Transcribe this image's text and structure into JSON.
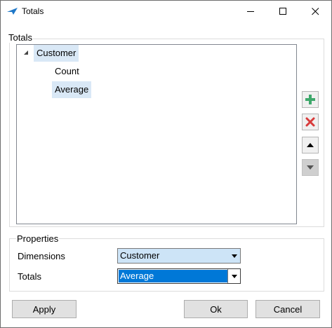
{
  "window": {
    "title": "Totals",
    "icon": "arrow-app-icon",
    "controls": [
      "minimize-icon",
      "maximize-icon",
      "close-icon"
    ]
  },
  "totals_group": {
    "label": "Totals",
    "tree": {
      "root": {
        "label": "Customer",
        "expanded": true,
        "selected": true
      },
      "children": [
        {
          "label": "Count",
          "selected": false
        },
        {
          "label": "Average",
          "selected": true
        }
      ]
    },
    "side_buttons": [
      {
        "icon": "plus-icon",
        "color": "#3ea86b",
        "enabled": true
      },
      {
        "icon": "x-icon",
        "color": "#d83b3b",
        "enabled": true
      },
      {
        "icon": "up-arrow-icon",
        "enabled": true
      },
      {
        "icon": "down-arrow-icon",
        "enabled": false
      }
    ]
  },
  "properties_group": {
    "label": "Properties",
    "dimensions": {
      "label": "Dimensions",
      "value": "Customer"
    },
    "totals": {
      "label": "Totals",
      "value": "Average"
    }
  },
  "buttons": {
    "apply": "Apply",
    "ok": "Ok",
    "cancel": "Cancel"
  },
  "colors": {
    "selection_light": "#d9e8f6",
    "selection_focus": "#0078d7"
  }
}
